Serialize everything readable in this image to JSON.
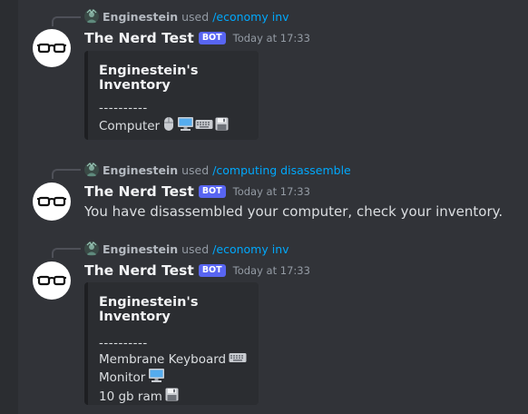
{
  "messages": [
    {
      "reply": {
        "user": "Enginestein",
        "used": "used",
        "command": "/economy inv"
      },
      "author": "The Nerd Test",
      "badge": "BOT",
      "time": "Today at 17:33",
      "embed": {
        "title": "Enginestein's Inventory",
        "separator": "----------",
        "lines": [
          {
            "text": "Computer",
            "icons": [
              "mouse-icon",
              "monitor-icon",
              "keyboard-icon",
              "floppy-disk-icon"
            ]
          }
        ]
      }
    },
    {
      "reply": {
        "user": "Enginestein",
        "used": "used",
        "command": "/computing disassemble"
      },
      "author": "The Nerd Test",
      "badge": "BOT",
      "time": "Today at 17:33",
      "text": "You have disassembled your computer, check your inventory."
    },
    {
      "reply": {
        "user": "Enginestein",
        "used": "used",
        "command": "/economy inv"
      },
      "author": "The Nerd Test",
      "badge": "BOT",
      "time": "Today at 17:33",
      "embed": {
        "title": "Enginestein's Inventory",
        "separator": "----------",
        "lines": [
          {
            "text": "Membrane Keyboard",
            "icons": [
              "keyboard-icon"
            ]
          },
          {
            "text": "Monitor",
            "icons": [
              "monitor-icon"
            ]
          },
          {
            "text": "10 gb ram",
            "icons": [
              "floppy-disk-icon"
            ]
          }
        ]
      }
    }
  ],
  "colors": {
    "background": "#313338",
    "embed": "#2b2d31",
    "bot_badge": "#5865f2",
    "command_link": "#00a8fc"
  }
}
